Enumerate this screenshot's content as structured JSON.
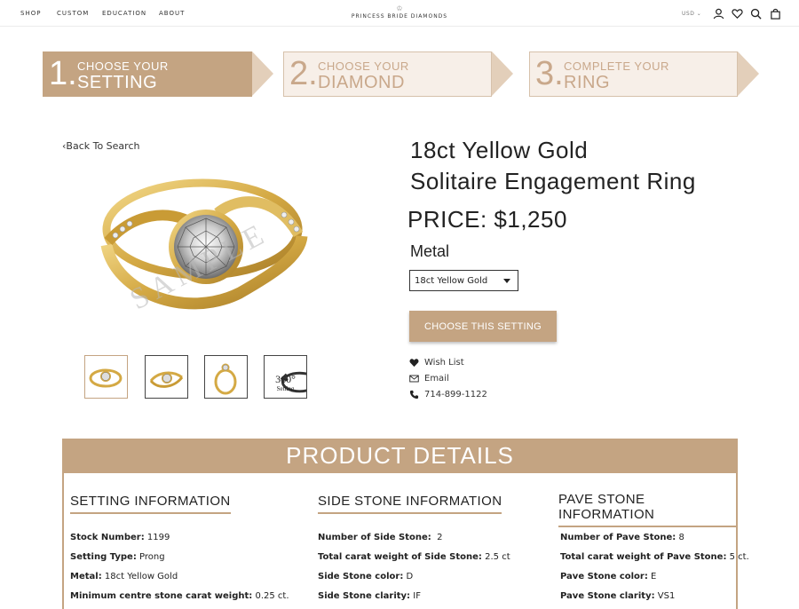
{
  "nav": {
    "items": [
      "SHOP",
      "CUSTOM",
      "EDUCATION",
      "ABOUT"
    ],
    "brand_name": "PRINCESS BRIDE DIAMONDS",
    "currency": "USD"
  },
  "steps": [
    {
      "number": "1.",
      "line1": "CHOOSE YOUR",
      "line2": "SETTING",
      "state": "active"
    },
    {
      "number": "2.",
      "line1": "CHOOSE YOUR",
      "line2": "DIAMOND",
      "state": "inactive"
    },
    {
      "number": "3.",
      "line1": "COMPLETE YOUR",
      "line2": "RING",
      "state": "inactive"
    }
  ],
  "product": {
    "back_label": "Back To Search",
    "watermark": "SAMPLE",
    "title_line1": "18ct Yellow Gold",
    "title_line2": "Solitaire Engagement Ring",
    "price": "PRICE: $1,250",
    "metal_label": "Metal",
    "metal_selected": "18ct Yellow Gold",
    "choose_button": "CHOOSE THIS SETTING",
    "thumb_360_number": "360°",
    "thumb_360_label": "Setting"
  },
  "actions": {
    "wish_list": "Wish List",
    "email": "Email",
    "phone": "714-899-1122"
  },
  "details": {
    "header": "PRODUCT DETAILS",
    "setting": {
      "title": "SETTING INFORMATION",
      "rows": [
        {
          "label": "Stock Number:",
          "value": "1199"
        },
        {
          "label": "Setting Type:",
          "value": "Prong"
        },
        {
          "label": "Metal:",
          "value": "18ct Yellow Gold"
        },
        {
          "label": "Minimum centre stone carat weight:",
          "value": "0.25 ct."
        }
      ]
    },
    "side_stone": {
      "title": "SIDE STONE INFORMATION",
      "rows": [
        {
          "label": "Number of Side Stone:",
          "value": "2"
        },
        {
          "label": "Total carat weight of Side Stone:",
          "value": "2.5 ct"
        },
        {
          "label": "Side Stone color:",
          "value": "D"
        },
        {
          "label": "Side Stone clarity:",
          "value": "IF"
        }
      ]
    },
    "pave_stone": {
      "title": "PAVE STONE INFORMATION",
      "rows": [
        {
          "label": "Number of Pave Stone:",
          "value": "8"
        },
        {
          "label": "Total carat weight of Pave Stone:",
          "value": "5 ct."
        },
        {
          "label": "Pave Stone color:",
          "value": "E"
        },
        {
          "label": "Pave Stone clarity:",
          "value": "VS1"
        }
      ]
    }
  },
  "colors": {
    "accent": "#c4a482",
    "step_inactive_bg": "#f7efe8",
    "gold": "#d9b45a"
  }
}
